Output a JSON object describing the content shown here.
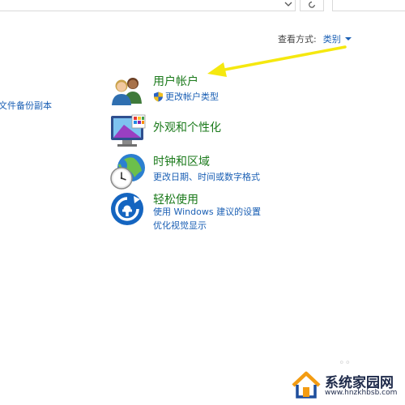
{
  "topbar": {
    "dropdown_icon": "chevron-down-icon",
    "refresh_icon": "refresh-icon"
  },
  "view_by": {
    "label": "查看方式:",
    "value": "类别"
  },
  "left_link": {
    "text": "文件备份副本"
  },
  "categories": [
    {
      "title": "用户帐户",
      "icon": "user-accounts-icon",
      "links": [
        "更改帐户类型"
      ],
      "links_shield": [
        true
      ]
    },
    {
      "title": "外观和个性化",
      "icon": "appearance-icon",
      "links": []
    },
    {
      "title": "时钟和区域",
      "icon": "clock-region-icon",
      "links": [
        "更改日期、时间或数字格式"
      ]
    },
    {
      "title": "轻松使用",
      "icon": "ease-of-access-icon",
      "links": [
        "使用 Windows 建议的设置",
        "优化视觉显示"
      ]
    }
  ],
  "colors": {
    "category_title": "#1b7a1b",
    "link": "#1a5fb4",
    "annotation_arrow": "#f5e80f"
  },
  "watermark": {
    "name": "系统家园网",
    "url": "www.hnzkhbsb.com"
  }
}
